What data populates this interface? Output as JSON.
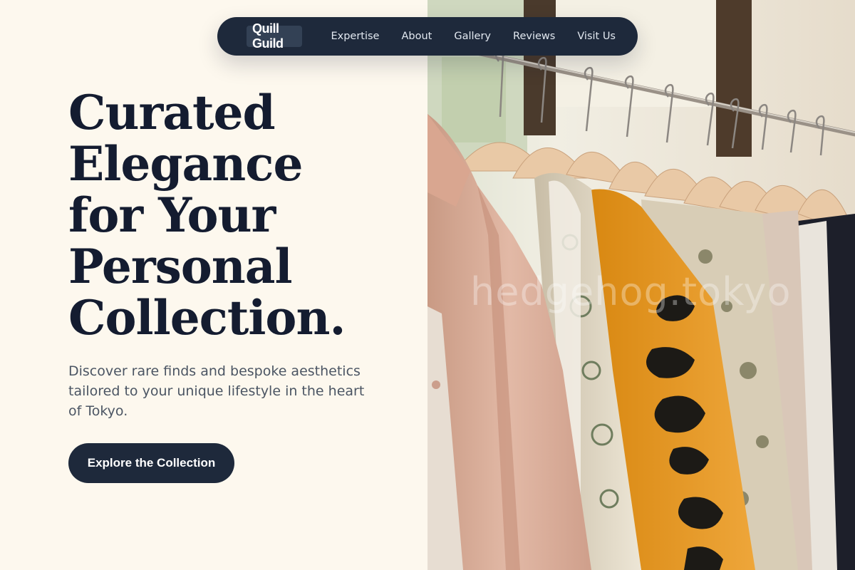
{
  "nav": {
    "brand": "Quill Guild",
    "links": [
      "Expertise",
      "About",
      "Gallery",
      "Reviews",
      "Visit Us"
    ]
  },
  "hero": {
    "title_lines": [
      "Curated",
      "Elegance",
      "for Your",
      "Personal",
      "Collection."
    ],
    "subtitle": "Discover rare finds and bespoke aesthetics tailored to your unique lifestyle in the heart of Tokyo.",
    "cta_label": "Explore the Collection"
  },
  "image": {
    "watermark": "hedgehog.tokyo"
  },
  "colors": {
    "navy": "#1e293b",
    "title": "#141c30",
    "cream": "#fdf8ee",
    "body_text": "#4b5563"
  }
}
